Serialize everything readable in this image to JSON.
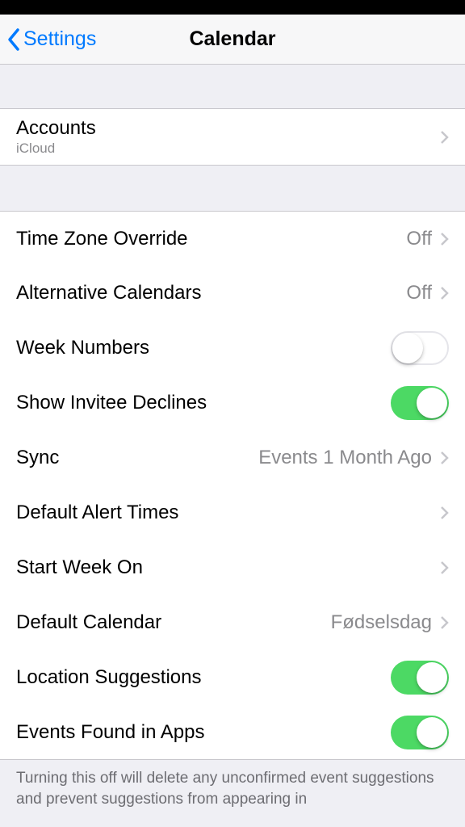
{
  "nav": {
    "back_label": "Settings",
    "title": "Calendar"
  },
  "accounts": {
    "label": "Accounts",
    "sublabel": "iCloud"
  },
  "rows": {
    "timezone": {
      "label": "Time Zone Override",
      "value": "Off"
    },
    "altcal": {
      "label": "Alternative Calendars",
      "value": "Off"
    },
    "weeknum": {
      "label": "Week Numbers"
    },
    "invitee": {
      "label": "Show Invitee Declines"
    },
    "sync": {
      "label": "Sync",
      "value": "Events 1 Month Ago"
    },
    "alert": {
      "label": "Default Alert Times"
    },
    "startweek": {
      "label": "Start Week On"
    },
    "defcal": {
      "label": "Default Calendar",
      "value": "Fødselsdag"
    },
    "locsug": {
      "label": "Location Suggestions"
    },
    "events": {
      "label": "Events Found in Apps"
    }
  },
  "footer": "Turning this off will delete any unconfirmed event suggestions and prevent suggestions from appearing in"
}
